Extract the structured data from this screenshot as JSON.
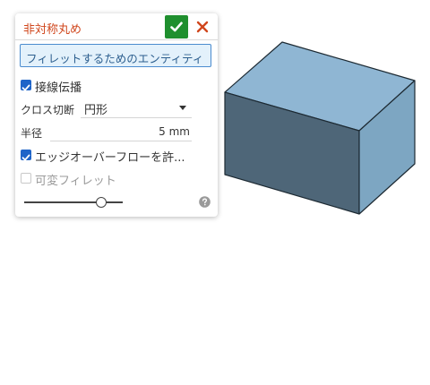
{
  "panel": {
    "title": "非対称丸め",
    "entity_placeholder": "フィレットするためのエンティティ",
    "tangent_propagation": {
      "label": "接線伝播",
      "checked": true
    },
    "cross_section": {
      "label": "クロス切断",
      "value": "円形"
    },
    "radius": {
      "label": "半径",
      "value": "5 mm"
    },
    "edge_overflow": {
      "label": "エッジオーバーフローを許...",
      "checked": true
    },
    "variable_fillet": {
      "label": "可変フィレット",
      "checked": false
    },
    "slider_fraction": 0.78
  },
  "icons": {
    "ok": "check-icon",
    "close": "close-icon",
    "dropdown": "caret-down-icon",
    "help": "help-icon"
  },
  "colors": {
    "title": "#d0461c",
    "ok_button": "#1f8f2e",
    "close": "#d0461c",
    "checkbox": "#1e64c8",
    "box_top": "#8fb6d3",
    "box_front": "#4e6678",
    "box_side": "#7da6c2"
  }
}
